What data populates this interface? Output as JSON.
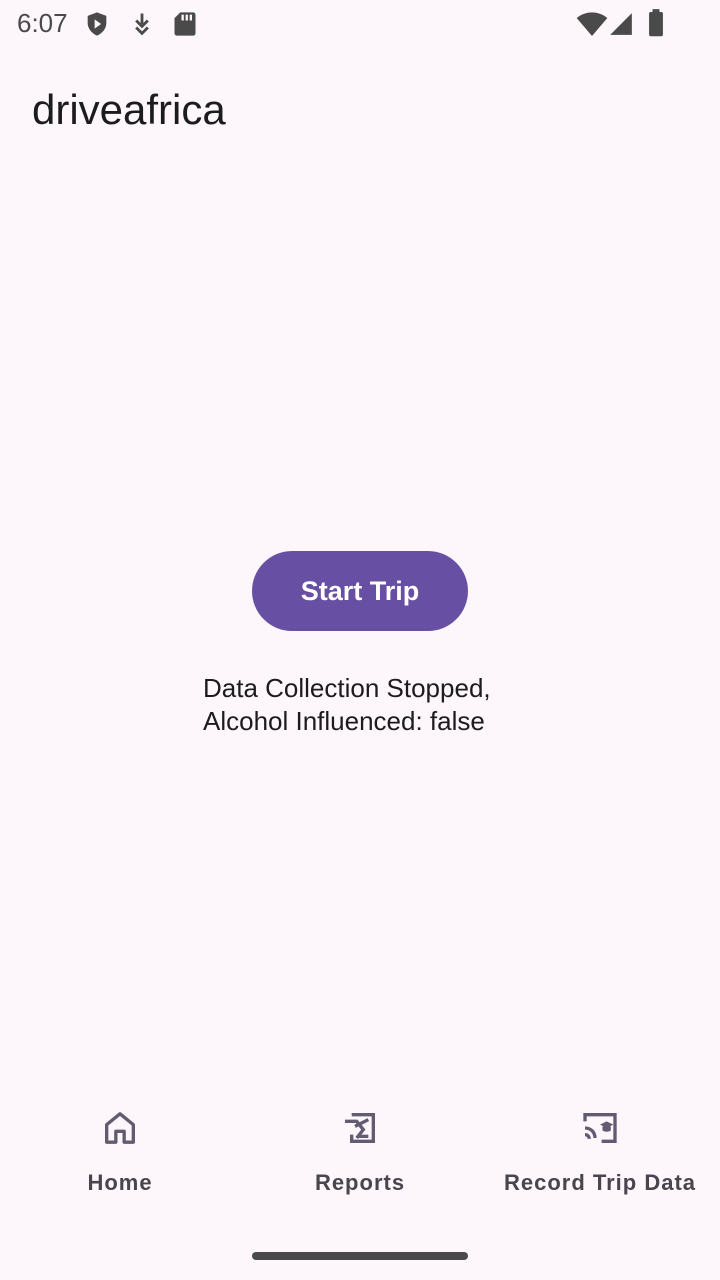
{
  "status_bar": {
    "time": "6:07",
    "left_icons": [
      "shield-play-icon",
      "download-arrow-icon",
      "sd-card-icon"
    ],
    "right_icons": [
      "wifi-icon",
      "cell-signal-icon",
      "battery-icon"
    ]
  },
  "app": {
    "title": "driveafrica"
  },
  "main": {
    "start_button_label": "Start Trip",
    "status_line_1": "Data Collection Stopped,",
    "status_line_2": "Alcohol Influenced: false"
  },
  "bottom_nav": {
    "items": [
      {
        "label": "Home",
        "icon": "home-icon"
      },
      {
        "label": "Reports",
        "icon": "reports-icon"
      },
      {
        "label": "Record Trip Data",
        "icon": "cast-record-icon"
      }
    ]
  },
  "colors": {
    "background": "#fdf7fb",
    "primary": "#6750a4",
    "on_primary": "#ffffff",
    "text": "#1c1b1f",
    "nav_text": "#49454f",
    "status_icons": "#4a4a4a"
  }
}
